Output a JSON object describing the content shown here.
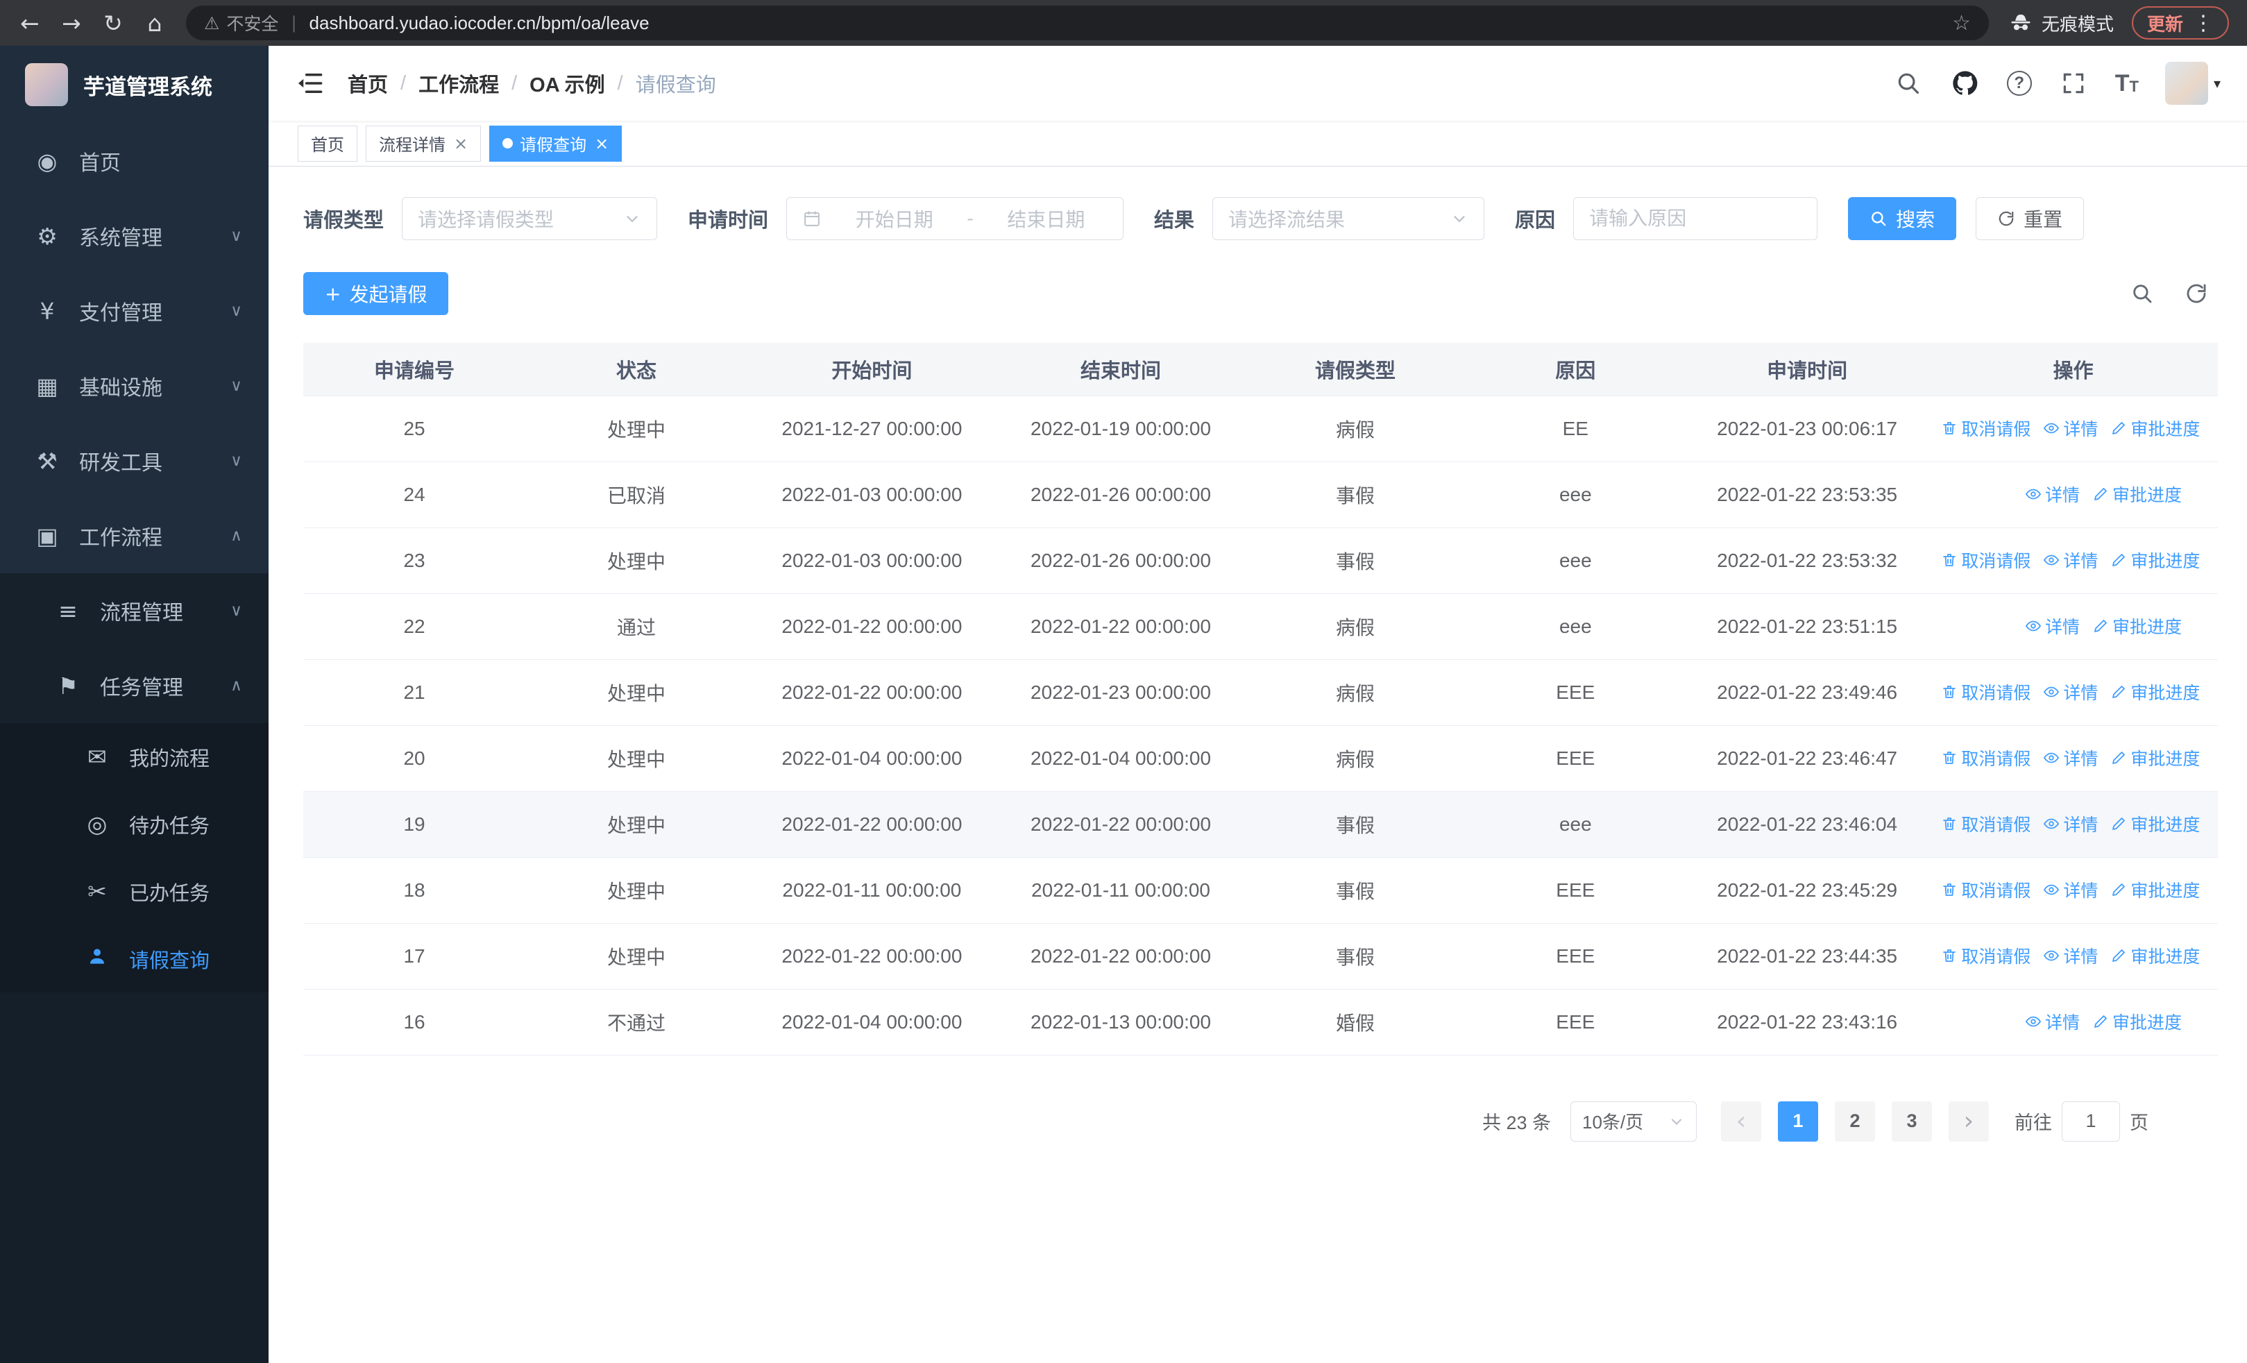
{
  "colors": {
    "accent": "#409eff",
    "sidebar_bg": "#1f2d3c",
    "update_chip": "#f28b82"
  },
  "browser": {
    "security_warning": "不安全",
    "url": "dashboard.yudao.iocoder.cn/bpm/oa/leave",
    "incognito_label": "无痕模式",
    "update_label": "更新"
  },
  "icons": {
    "back": "←",
    "forward": "→",
    "reload": "↻",
    "home": "⌂",
    "warning": "⚠",
    "divider": "|",
    "star": "☆",
    "kebab": "⋮",
    "question": "?",
    "text_size": "T",
    "caret": "▾",
    "plus": "+",
    "prev": "‹",
    "next": "›",
    "chev_down": "∨",
    "chev_up": "∧",
    "close": "×"
  },
  "sidebar": {
    "logo_title": "芋道管理系统",
    "items": [
      {
        "label": "首页",
        "icon": "◉"
      },
      {
        "label": "系统管理",
        "icon": "⚙"
      },
      {
        "label": "支付管理",
        "icon": "¥"
      },
      {
        "label": "基础设施",
        "icon": "▦"
      },
      {
        "label": "研发工具",
        "icon": "⚒"
      },
      {
        "label": "工作流程",
        "icon": "▣"
      }
    ],
    "submenu": [
      {
        "label": "流程管理",
        "icon": "≡"
      },
      {
        "label": "任务管理",
        "icon": "⚑"
      }
    ],
    "task_items": [
      {
        "label": "我的流程",
        "icon": "✉"
      },
      {
        "label": "待办任务",
        "icon": "◎"
      },
      {
        "label": "已办任务",
        "icon": "✂"
      },
      {
        "label": "请假查询",
        "icon": ""
      }
    ]
  },
  "header": {
    "breadcrumb": [
      "首页",
      "工作流程",
      "OA 示例",
      "请假查询"
    ]
  },
  "tabs": [
    {
      "label": "首页"
    },
    {
      "label": "流程详情"
    },
    {
      "label": "请假查询"
    }
  ],
  "filters": {
    "leave_type_label": "请假类型",
    "leave_type_placeholder": "请选择请假类型",
    "apply_time_label": "申请时间",
    "start_date_placeholder": "开始日期",
    "range_separator": "-",
    "end_date_placeholder": "结束日期",
    "result_label": "结果",
    "result_placeholder": "请选择流结果",
    "reason_label": "原因",
    "reason_placeholder": "请输入原因",
    "search_button": "搜索",
    "reset_button": "重置"
  },
  "toolbar": {
    "create_button": "发起请假"
  },
  "table": {
    "columns": [
      "申请编号",
      "状态",
      "开始时间",
      "结束时间",
      "请假类型",
      "原因",
      "申请时间",
      "操作"
    ],
    "op_labels": {
      "cancel": "取消请假",
      "detail": "详情",
      "progress": "审批进度"
    },
    "rows": [
      {
        "id": "25",
        "status": "处理中",
        "start": "2021-12-27 00:00:00",
        "end": "2022-01-19 00:00:00",
        "type": "病假",
        "reason": "EE",
        "applied": "2022-01-23 00:06:17",
        "ops": [
          "cancel",
          "detail",
          "progress"
        ]
      },
      {
        "id": "24",
        "status": "已取消",
        "start": "2022-01-03 00:00:00",
        "end": "2022-01-26 00:00:00",
        "type": "事假",
        "reason": "eee",
        "applied": "2022-01-22 23:53:35",
        "ops": [
          "detail",
          "progress"
        ]
      },
      {
        "id": "23",
        "status": "处理中",
        "start": "2022-01-03 00:00:00",
        "end": "2022-01-26 00:00:00",
        "type": "事假",
        "reason": "eee",
        "applied": "2022-01-22 23:53:32",
        "ops": [
          "cancel",
          "detail",
          "progress"
        ]
      },
      {
        "id": "22",
        "status": "通过",
        "start": "2022-01-22 00:00:00",
        "end": "2022-01-22 00:00:00",
        "type": "病假",
        "reason": "eee",
        "applied": "2022-01-22 23:51:15",
        "ops": [
          "detail",
          "progress"
        ]
      },
      {
        "id": "21",
        "status": "处理中",
        "start": "2022-01-22 00:00:00",
        "end": "2022-01-23 00:00:00",
        "type": "病假",
        "reason": "EEE",
        "applied": "2022-01-22 23:49:46",
        "ops": [
          "cancel",
          "detail",
          "progress"
        ]
      },
      {
        "id": "20",
        "status": "处理中",
        "start": "2022-01-04 00:00:00",
        "end": "2022-01-04 00:00:00",
        "type": "病假",
        "reason": "EEE",
        "applied": "2022-01-22 23:46:47",
        "ops": [
          "cancel",
          "detail",
          "progress"
        ]
      },
      {
        "id": "19",
        "status": "处理中",
        "start": "2022-01-22 00:00:00",
        "end": "2022-01-22 00:00:00",
        "type": "事假",
        "reason": "eee",
        "applied": "2022-01-22 23:46:04",
        "ops": [
          "cancel",
          "detail",
          "progress"
        ],
        "highlighted": true
      },
      {
        "id": "18",
        "status": "处理中",
        "start": "2022-01-11 00:00:00",
        "end": "2022-01-11 00:00:00",
        "type": "事假",
        "reason": "EEE",
        "applied": "2022-01-22 23:45:29",
        "ops": [
          "cancel",
          "detail",
          "progress"
        ]
      },
      {
        "id": "17",
        "status": "处理中",
        "start": "2022-01-22 00:00:00",
        "end": "2022-01-22 00:00:00",
        "type": "事假",
        "reason": "EEE",
        "applied": "2022-01-22 23:44:35",
        "ops": [
          "cancel",
          "detail",
          "progress"
        ]
      },
      {
        "id": "16",
        "status": "不通过",
        "start": "2022-01-04 00:00:00",
        "end": "2022-01-13 00:00:00",
        "type": "婚假",
        "reason": "EEE",
        "applied": "2022-01-22 23:43:16",
        "ops": [
          "detail",
          "progress"
        ]
      }
    ]
  },
  "pagination": {
    "total_text": "共 23 条",
    "page_size": "10条/页",
    "pages": [
      "1",
      "2",
      "3"
    ],
    "active_page": "1",
    "goto_prefix": "前往",
    "goto_value": "1",
    "goto_suffix": "页"
  }
}
